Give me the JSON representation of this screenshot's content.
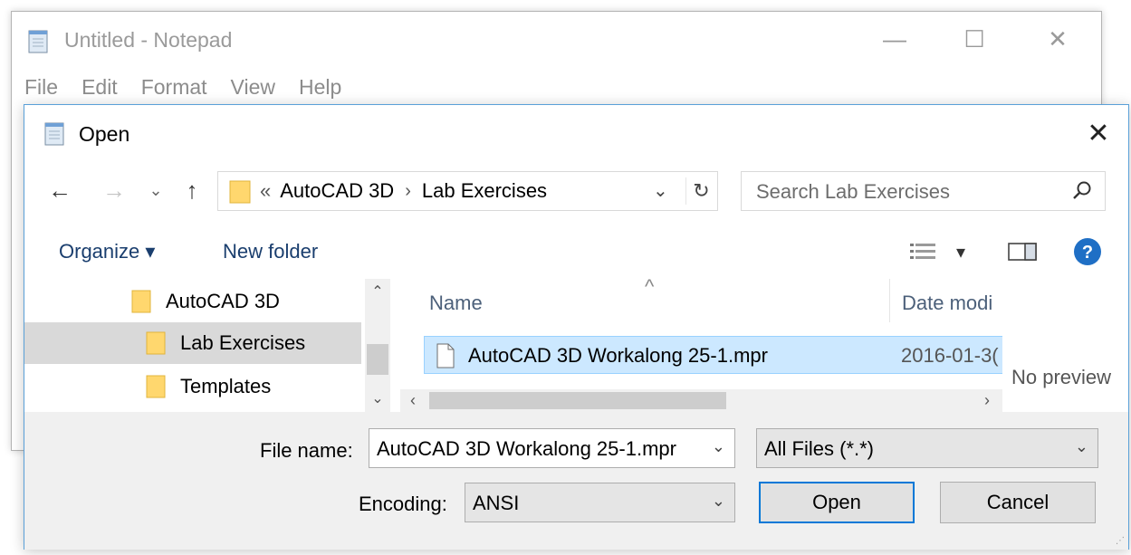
{
  "notepad": {
    "title": "Untitled - Notepad",
    "menu": [
      "File",
      "Edit",
      "Format",
      "View",
      "Help"
    ],
    "minimize": "—",
    "maximize": "☐",
    "close": "✕"
  },
  "dialog": {
    "title": "Open",
    "close": "✕",
    "nav": {
      "back": "←",
      "forward": "→",
      "recent": "⌄",
      "up": "↑"
    },
    "address": {
      "prefix": "«",
      "crumbs": [
        "AutoCAD 3D",
        "Lab Exercises"
      ],
      "separator": "›",
      "dropdown": "⌄",
      "refresh": "↻"
    },
    "search": {
      "placeholder": "Search Lab Exercises"
    },
    "toolbar": {
      "organize": "Organize ▾",
      "new_folder": "New folder",
      "view_dropdown": "▾",
      "help": "?"
    },
    "tree": [
      {
        "label": "AutoCAD 3D"
      },
      {
        "label": "Lab Exercises",
        "selected": true
      },
      {
        "label": "Templates"
      }
    ],
    "tree_scroll": {
      "up": "⌃",
      "down": "⌄"
    },
    "columns": {
      "sort_indicator": "^",
      "name": "Name",
      "date": "Date modi"
    },
    "files": [
      {
        "name": "AutoCAD 3D Workalong 25-1.mpr",
        "date": "2016-01-3("
      }
    ],
    "hscroll": {
      "left": "‹",
      "right": "›"
    },
    "preview": "No preview",
    "file_name_label": "File name:",
    "file_name_value": "AutoCAD 3D Workalong 25-1.mpr",
    "file_type": "All Files  (*.*)",
    "encoding_label": "Encoding:",
    "encoding_value": "ANSI",
    "chevron": "⌄",
    "open_button": "Open",
    "cancel_button": "Cancel",
    "grip": "⋰"
  },
  "colors": {
    "accent": "#0078d7",
    "selection": "#cce8ff",
    "folder": "#ffd76e",
    "help": "#1f6fc5"
  }
}
